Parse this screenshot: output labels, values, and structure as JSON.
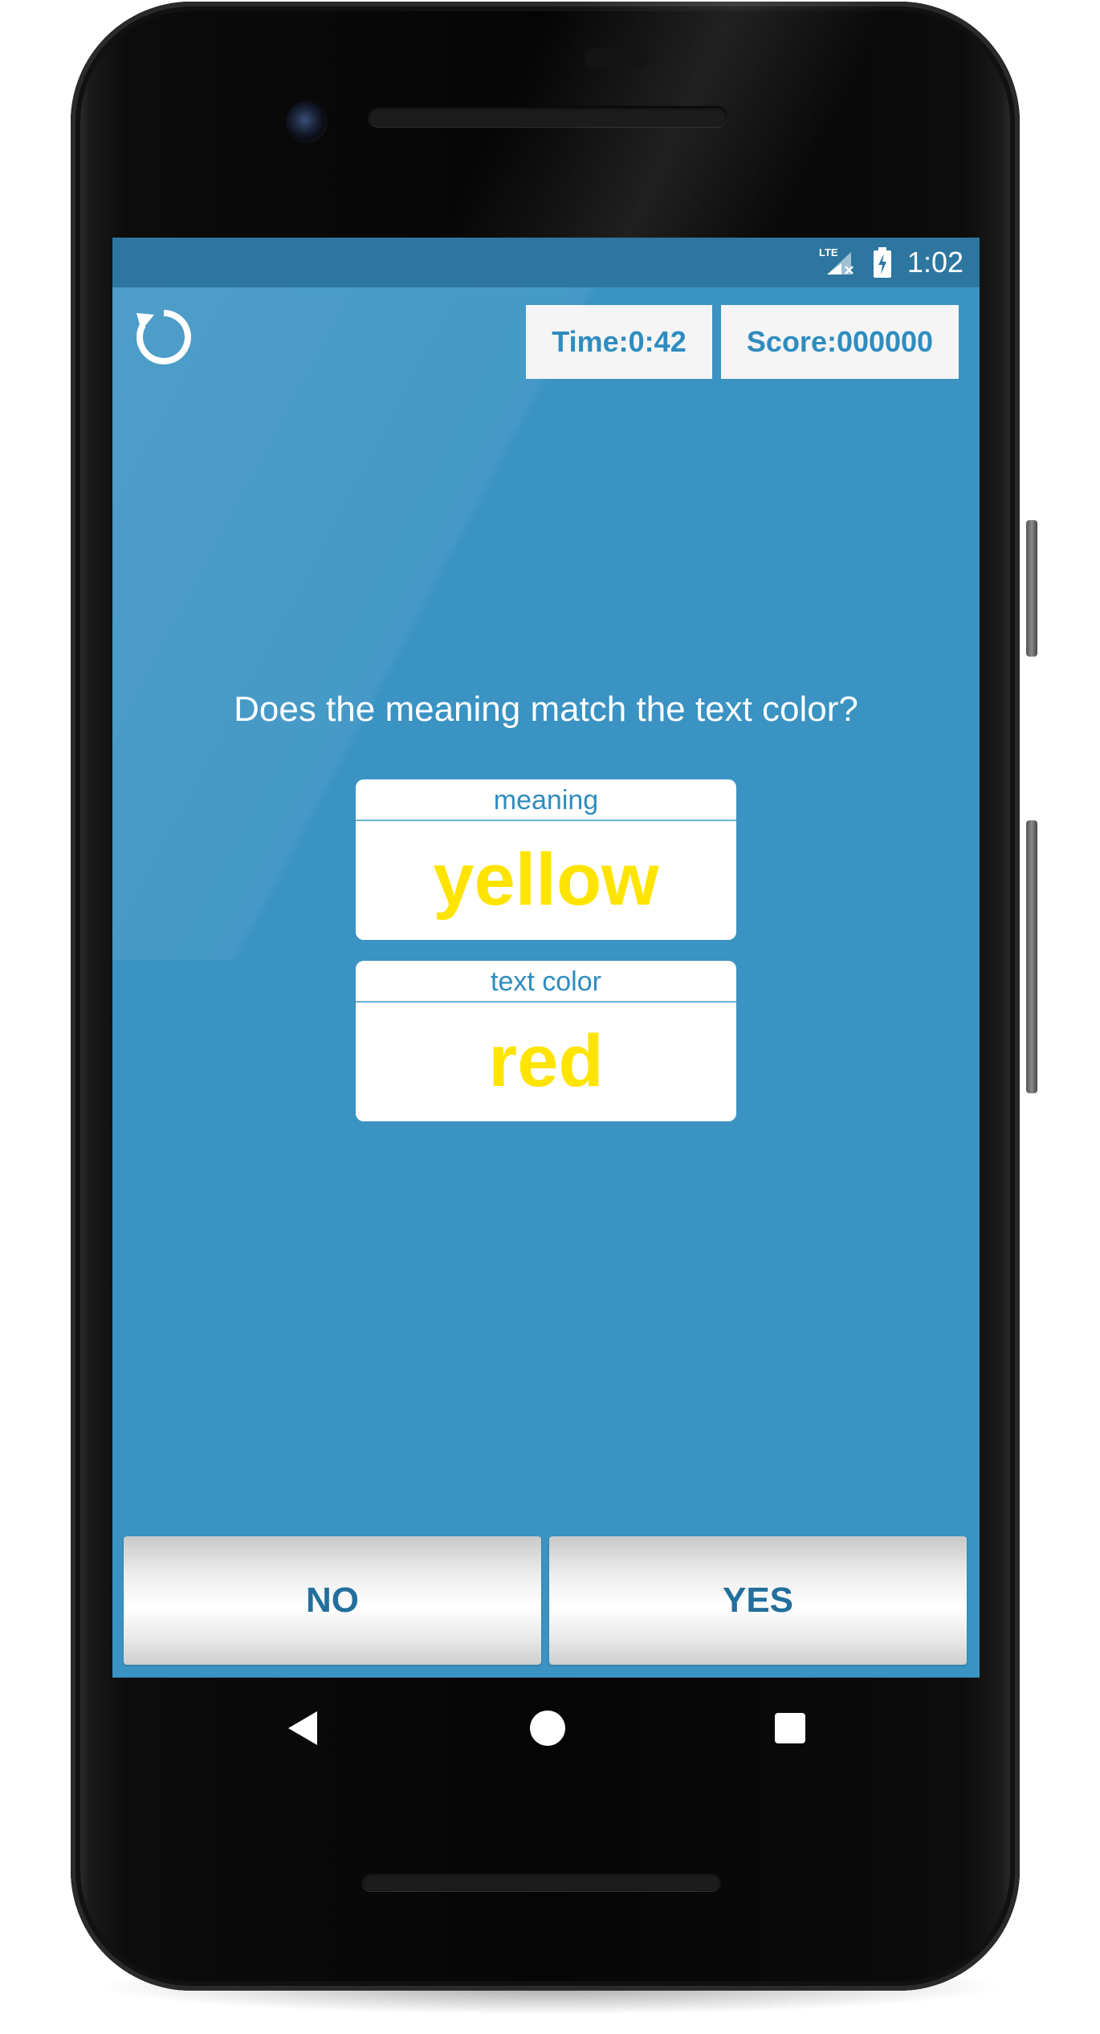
{
  "status_bar": {
    "network_label": "LTE",
    "time": "1:02",
    "icons": [
      "lte-signal-icon",
      "battery-charging-icon"
    ]
  },
  "toolbar": {
    "restart_icon": "refresh-icon",
    "time_label": "Time:",
    "time_value": "0:42",
    "score_label": "Score:",
    "score_value": "000000"
  },
  "game": {
    "question": "Does the meaning match the text color?",
    "meaning_card": {
      "label": "meaning",
      "word": "yellow"
    },
    "text_color_card": {
      "label": "text color",
      "word": "red"
    }
  },
  "answers": {
    "no_label": "NO",
    "yes_label": "YES"
  },
  "navigation": {
    "icons": [
      "back-icon",
      "home-icon",
      "recents-icon"
    ]
  },
  "colors": {
    "background": "#3a93c2",
    "status_bar": "#2d76a0",
    "accent_text": "#2f8cbf",
    "word_color": "#ffe400",
    "button_text": "#236f9c"
  }
}
